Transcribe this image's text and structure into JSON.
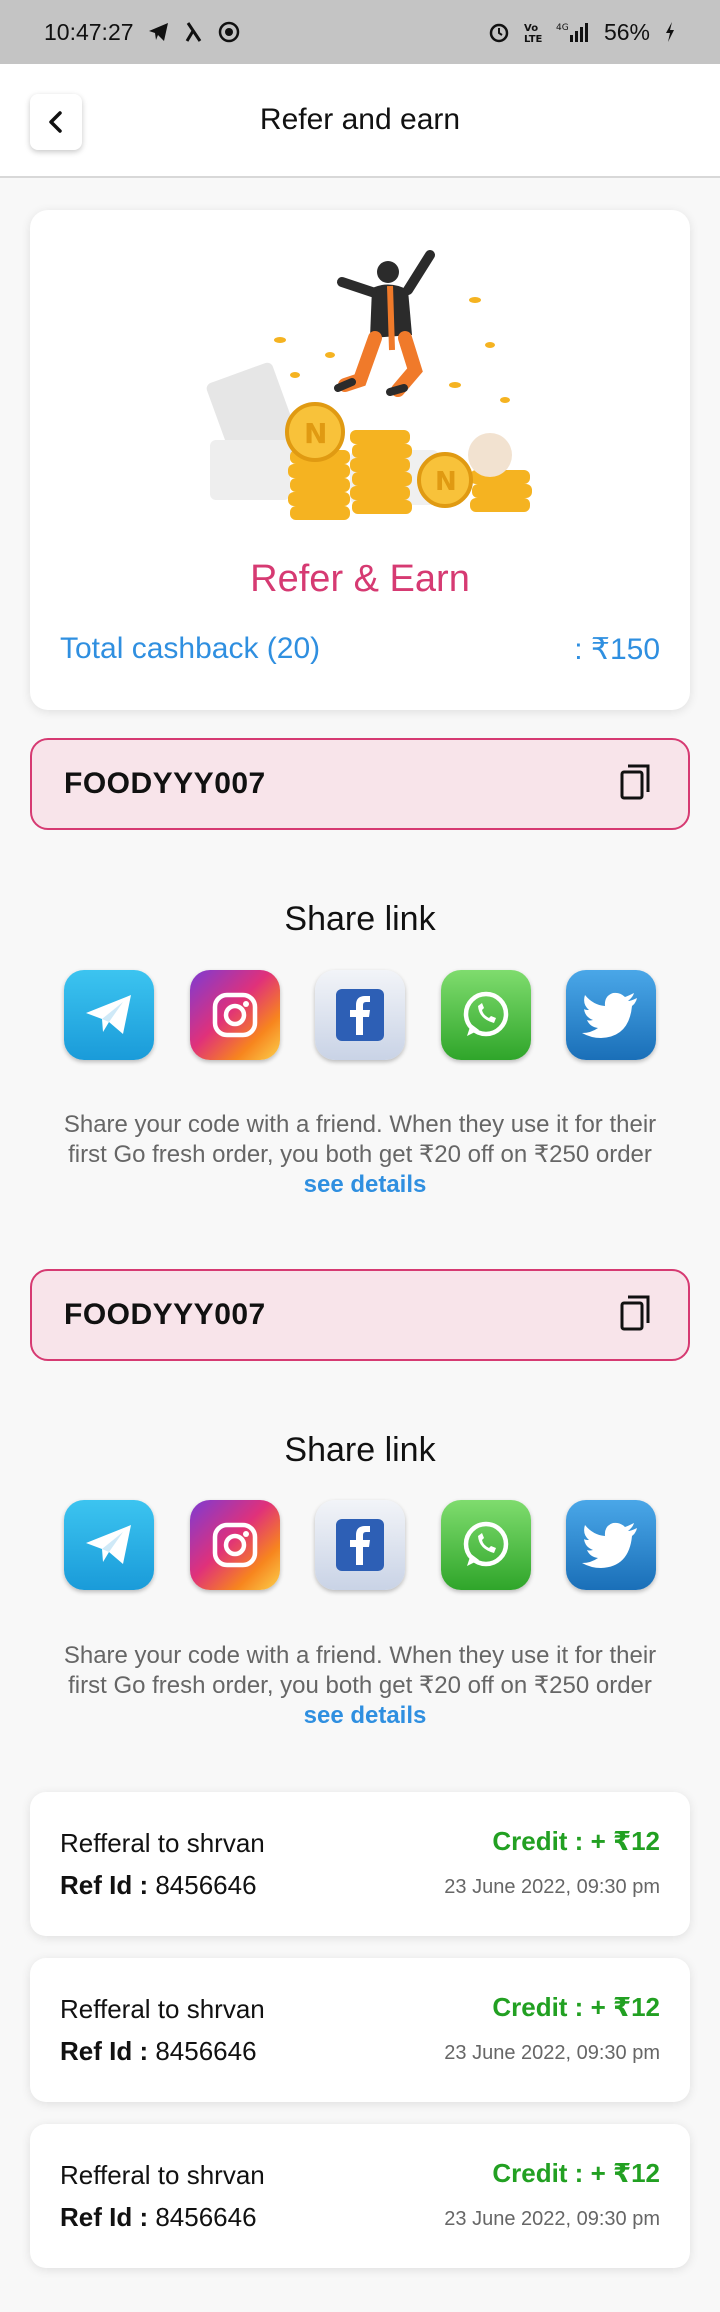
{
  "status_bar": {
    "time": "10:47:27",
    "battery": "56%",
    "network": "4G"
  },
  "header": {
    "title": "Refer and earn"
  },
  "hero": {
    "title": "Refer & Earn",
    "cashback_label": "Total cashback (20)",
    "cashback_value": ":  ₹150"
  },
  "sections": [
    {
      "code": "FOODYYY007",
      "share_title": "Share link",
      "description": "Share your code with a friend. When they use it for their first Go fresh order, you both get ₹20 off on ₹250 order",
      "details_link": "see details",
      "apps": [
        "telegram-icon",
        "instagram-icon",
        "facebook-icon",
        "whatsapp-icon",
        "twitter-icon"
      ]
    },
    {
      "code": "FOODYYY007",
      "share_title": "Share link",
      "description": "Share your code with a friend. When they use it for their first Go fresh order, you both get ₹20 off on ₹250 order",
      "details_link": "see details",
      "apps": [
        "telegram-icon",
        "instagram-icon",
        "facebook-icon",
        "whatsapp-icon",
        "twitter-icon"
      ]
    }
  ],
  "referrals": [
    {
      "name": "Refferal to shrvan",
      "ref_label": "Ref Id :",
      "ref_id": "8456646",
      "credit": "Credit :  + ₹12",
      "date": "23 June 2022, 09:30 pm"
    },
    {
      "name": "Refferal to shrvan",
      "ref_label": "Ref Id :",
      "ref_id": "8456646",
      "credit": "Credit :  + ₹12",
      "date": "23 June 2022, 09:30 pm"
    },
    {
      "name": "Refferal to shrvan",
      "ref_label": "Ref Id :",
      "ref_id": "8456646",
      "credit": "Credit :  + ₹12",
      "date": "23 June 2022, 09:30 pm"
    }
  ],
  "colors": {
    "accent_pink": "#d63a72",
    "link_blue": "#2f8fe0",
    "credit_green": "#22a022",
    "code_bg": "#f8e4ea"
  }
}
